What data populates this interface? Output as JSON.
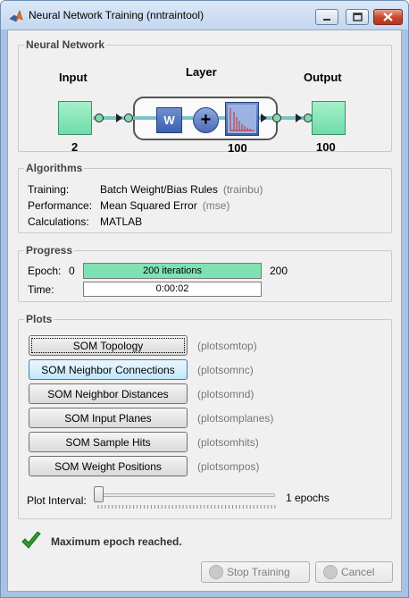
{
  "window": {
    "title": "Neural Network Training (nntraintool)"
  },
  "network": {
    "section_title": "Neural Network",
    "input_label": "Input",
    "input_size": "2",
    "layer_label": "Layer",
    "weight_label": "W",
    "sum_symbol": "+",
    "layer_size": "100",
    "output_label": "Output",
    "output_size": "100"
  },
  "algorithms": {
    "section_title": "Algorithms",
    "rows": [
      {
        "key": "Training:",
        "value": "Batch Weight/Bias Rules",
        "fn": "(trainbu)"
      },
      {
        "key": "Performance:",
        "value": "Mean Squared Error",
        "fn": "(mse)"
      },
      {
        "key": "Calculations:",
        "value": "MATLAB",
        "fn": ""
      }
    ]
  },
  "progress": {
    "section_title": "Progress",
    "epoch": {
      "label": "Epoch:",
      "min": "0",
      "text": "200 iterations",
      "max": "200",
      "fraction": 1.0
    },
    "time": {
      "label": "Time:",
      "text": "0:00:02"
    }
  },
  "plots": {
    "section_title": "Plots",
    "buttons": [
      {
        "label": "SOM Topology",
        "fn": "(plotsomtop)"
      },
      {
        "label": "SOM Neighbor Connections",
        "fn": "(plotsomnc)"
      },
      {
        "label": "SOM Neighbor Distances",
        "fn": "(plotsomnd)"
      },
      {
        "label": "SOM Input Planes",
        "fn": "(plotsomplanes)"
      },
      {
        "label": "SOM Sample Hits",
        "fn": "(plotsomhits)"
      },
      {
        "label": "SOM Weight Positions",
        "fn": "(plotsompos)"
      }
    ],
    "interval_label": "Plot Interval:",
    "interval_value": "1 epochs",
    "interval_position": 0
  },
  "status": {
    "icon": "checkmark-icon",
    "text": "Maximum epoch reached."
  },
  "footer": {
    "stop_label": "Stop Training",
    "cancel_label": "Cancel"
  },
  "colors": {
    "progress_fill": "#7ee2b3",
    "node_fill": "#7fd8b0",
    "layer_blue": "#3c5fb0",
    "status_green": "#2e9b2e"
  }
}
